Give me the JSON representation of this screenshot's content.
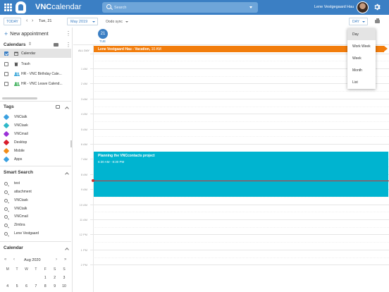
{
  "app": {
    "brand_bold": "VNC",
    "brand_light": "calendar"
  },
  "search": {
    "placeholder": "Search"
  },
  "user": {
    "name": "Lene Vestgegaard Hau"
  },
  "toolbar": {
    "today": "TODAY",
    "prev": "‹",
    "next": "›",
    "date": "Tue, 21",
    "month": "May 2019",
    "odoo": "Oodo sync",
    "view": "DAY"
  },
  "sidebar": {
    "new_appointment": "New appointment",
    "calendars_title": "Calendars",
    "calendars": [
      {
        "label": "Calendar",
        "checked": true
      },
      {
        "label": "Trash",
        "checked": false
      },
      {
        "label": "HR - VNC Birthday Cale...",
        "checked": false
      },
      {
        "label": "HR - VNC Leave Calend...",
        "checked": false
      }
    ],
    "tags_title": "Tags",
    "tags": [
      {
        "label": "VNCtalk",
        "color": "#3aa0e0"
      },
      {
        "label": "VNCtask",
        "color": "#2eb8c8"
      },
      {
        "label": "VNCmail",
        "color": "#9b30d8"
      },
      {
        "label": "Desktop",
        "color": "#d81c2c"
      },
      {
        "label": "Mobile",
        "color": "#f28c18"
      },
      {
        "label": "Apps",
        "color": "#3aa0e0"
      }
    ],
    "smart_search_title": "Smart Search",
    "smart_searches": [
      "test",
      "attachment",
      "VNCtask",
      "VNCtalk",
      "VNCmail",
      "Zimbra",
      "Lene Vestgaard"
    ],
    "calendar_title": "Calendar",
    "mini_month": "Aug 2020",
    "mini_nav": {
      "first": "«",
      "prev": "‹",
      "next": "›",
      "last": "»"
    },
    "mini_dow": [
      "M",
      "T",
      "W",
      "T",
      "F",
      "S",
      "S"
    ],
    "mini_days": [
      "",
      "",
      "",
      "",
      "1",
      "2",
      "3",
      "4",
      "5",
      "6",
      "7",
      "8",
      "9",
      "10"
    ]
  },
  "day_header": {
    "date": "21",
    "weekday": "TUE"
  },
  "allday_label": "ALL DAY",
  "hours": [
    "1 AM",
    "2 AM",
    "3 AM",
    "4 AM",
    "5 AM",
    "6 AM",
    "7 AM",
    "8 AM",
    "9 AM",
    "10 AM",
    "11 AM",
    "12 PM",
    "1 PM",
    "2 PM"
  ],
  "allday_event": {
    "title": "Lene Vestgaard Hau - Vacation,",
    "time": "10 AM",
    "color": "#f27d0c"
  },
  "event": {
    "title": "Planning the VNCcontacts project",
    "time": "6:30 AM - 8:30 PM",
    "color": "#00b4d0"
  },
  "view_menu": {
    "items": [
      "Day",
      "Work Week",
      "Week",
      "Month",
      "List"
    ],
    "selected": "Day"
  },
  "colors": {
    "primary": "#3b7fc4",
    "now_line": "#d23030"
  }
}
